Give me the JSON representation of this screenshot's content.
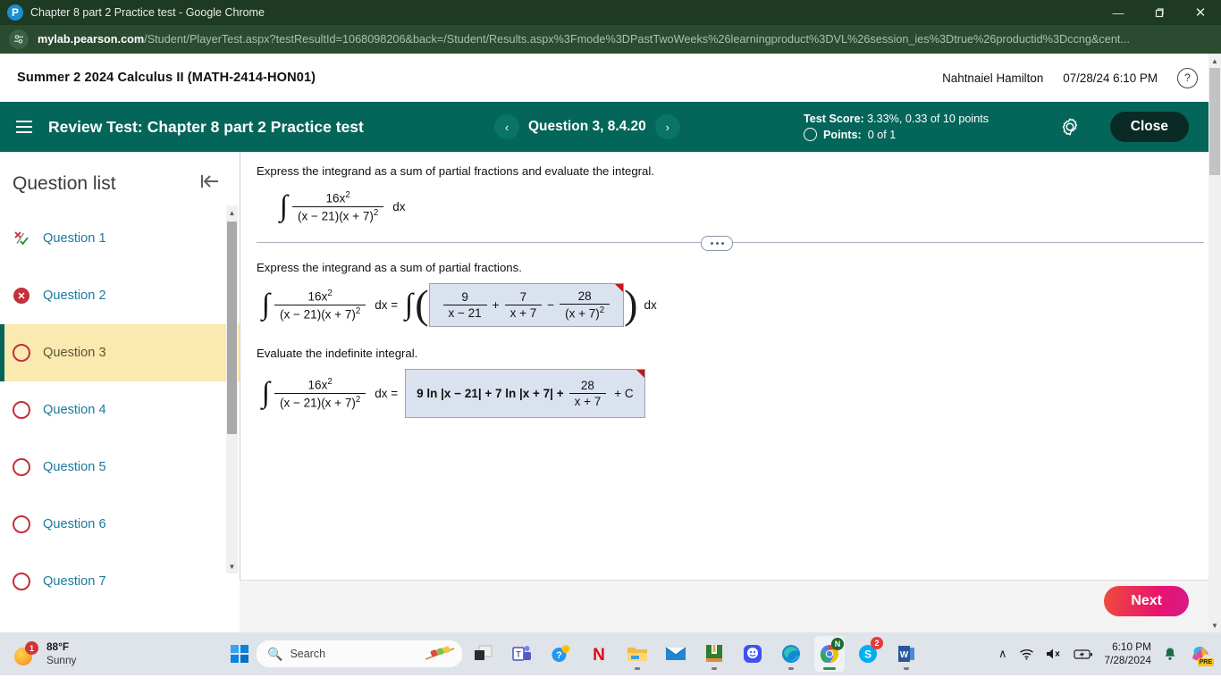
{
  "browser": {
    "tab_title": "Chapter 8 part 2 Practice test - Google Chrome",
    "favicon": "pearson-p-icon",
    "url_domain": "mylab.pearson.com",
    "url_path": "/Student/PlayerTest.aspx?testResultId=1068098206&back=/Student/Results.aspx%3Fmode%3DPastTwoWeeks%26learningproduct%3DVL%26session_ies%3Dtrue%26productid%3Dccng&cent...",
    "window_controls": {
      "minimize": "—",
      "maximize": "❐",
      "close": "✕"
    }
  },
  "course_bar": {
    "course_title": "Summer 2 2024 Calculus II (MATH-2414-HON01)",
    "student_name": "Nahtnaiel Hamilton",
    "timestamp": "07/28/24 6:10 PM",
    "help_label": "?"
  },
  "test_header": {
    "menu_icon": "hamburger-menu-icon",
    "lead_label": "Review Test:",
    "test_name": "Chapter 8 part 2 Practice test",
    "prev_label": "‹",
    "next_label": "›",
    "question_label": "Question 3, 8.4.20",
    "score_label": "Test Score:",
    "score_value": "3.33%, 0.33 of 10 points",
    "points_label": "Points:",
    "points_value": "0 of 1",
    "settings_icon": "gear-icon",
    "close_label": "Close",
    "accent_color": "#04655a"
  },
  "sidebar": {
    "title": "Question list",
    "collapse_icon": "collapse-left-icon",
    "items": [
      {
        "label": "Question 1",
        "status": "partial"
      },
      {
        "label": "Question 2",
        "status": "incorrect"
      },
      {
        "label": "Question 3",
        "status": "unanswered",
        "active": true
      },
      {
        "label": "Question 4",
        "status": "unanswered"
      },
      {
        "label": "Question 5",
        "status": "unanswered"
      },
      {
        "label": "Question 6",
        "status": "unanswered"
      },
      {
        "label": "Question 7",
        "status": "unanswered"
      }
    ],
    "highlight_color": "#fbeab0"
  },
  "question": {
    "prompt": "Express the integrand as a sum of partial fractions and evaluate the integral.",
    "integral": {
      "numerator": "16x",
      "numerator_sup": "2",
      "denominator": "(x − 21)(x + 7)",
      "denominator_sup": "2",
      "differential": "dx"
    },
    "part1": {
      "prompt": "Express the integrand as a sum of partial fractions.",
      "equals": "dx =",
      "terms": [
        {
          "op": "",
          "num": "9",
          "den": "x − 21",
          "den_sup": ""
        },
        {
          "op": "+",
          "num": "7",
          "den": "x + 7",
          "den_sup": ""
        },
        {
          "op": "−",
          "num": "28",
          "den": "(x + 7)",
          "den_sup": "2"
        }
      ],
      "trailing": "dx",
      "marked": true
    },
    "part2": {
      "prompt": "Evaluate the indefinite integral.",
      "equals": "dx =",
      "answer_lead": "9 ln |x − 21| + 7 ln |x + 7| +",
      "answer_frac_num": "28",
      "answer_frac_den": "x + 7",
      "answer_tail": "+ C",
      "marked": true
    },
    "answer_box_color": "#dbe2ef",
    "marker_color": "#c4161c"
  },
  "footer": {
    "next_label": "Next"
  },
  "taskbar": {
    "weather": {
      "temp": "88°F",
      "condition": "Sunny",
      "badge": "1",
      "icon": "sun-icon"
    },
    "start_icon": "windows-logo-icon",
    "search": {
      "placeholder": "Search",
      "icon": "search-icon",
      "image": "food-skewer-icon"
    },
    "apps": [
      {
        "name": "task-view",
        "label": ""
      },
      {
        "name": "microsoft-teams",
        "label": "T"
      },
      {
        "name": "help-app",
        "label": "?"
      },
      {
        "name": "netflix",
        "label": "N"
      },
      {
        "name": "file-explorer",
        "label": ""
      },
      {
        "name": "mail",
        "label": ""
      },
      {
        "name": "kindle-books",
        "label": ""
      },
      {
        "name": "messaging",
        "label": ""
      },
      {
        "name": "microsoft-edge",
        "label": ""
      },
      {
        "name": "google-chrome",
        "label": "",
        "active": true,
        "badge": "N"
      },
      {
        "name": "skype",
        "label": "S",
        "badge": "2"
      },
      {
        "name": "microsoft-word",
        "label": "W"
      }
    ],
    "tray": {
      "chevron": "∧",
      "wifi_icon": "wifi-icon",
      "volume_icon": "volume-muted-icon",
      "battery_icon": "battery-charging-icon",
      "time": "6:10 PM",
      "date": "7/28/2024",
      "notification_icon": "bell-icon",
      "copilot_label": "PRE"
    }
  }
}
